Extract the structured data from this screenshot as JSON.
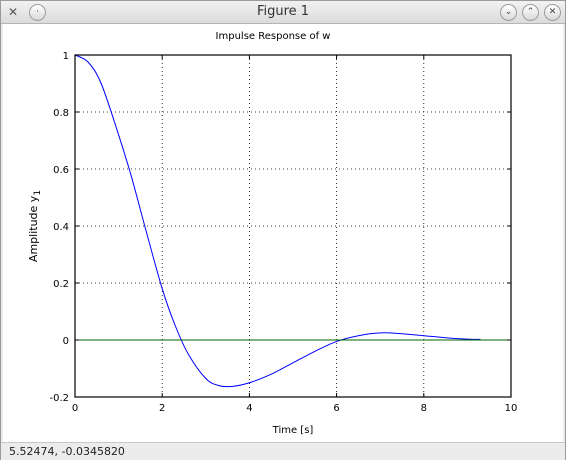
{
  "window": {
    "title": "Figure 1",
    "app_icon": "matplotlib-x-icon",
    "buttons": [
      {
        "name": "minimize",
        "glyph": "⌄"
      },
      {
        "name": "maximize",
        "glyph": "⌃"
      },
      {
        "name": "close",
        "glyph": "✕"
      }
    ],
    "menu_button_glyph": "·"
  },
  "status": {
    "coordinates": "5.52474, -0.0345820"
  },
  "chart_data": {
    "type": "line",
    "title": "Impulse Response of w",
    "xlabel": "Time [s]",
    "ylabel": "Amplitude y",
    "ylabel_subscript": "1",
    "xlim": [
      0,
      10
    ],
    "ylim": [
      -0.2,
      1
    ],
    "xticks": [
      0,
      2,
      4,
      6,
      8,
      10
    ],
    "yticks": [
      -0.2,
      0,
      0.2,
      0.4,
      0.6,
      0.8,
      1
    ],
    "grid": true,
    "series": [
      {
        "color": "#0000ff",
        "x": [
          0,
          0.3,
          0.6,
          1.0,
          1.3,
          1.6,
          2.0,
          2.3,
          2.6,
          3.0,
          3.3,
          3.6,
          4.0,
          4.5,
          5.0,
          5.5,
          6.0,
          6.5,
          7.0,
          7.5,
          8.0,
          8.5,
          9.0,
          9.3
        ],
        "y": [
          1.0,
          0.975,
          0.9,
          0.72,
          0.57,
          0.4,
          0.18,
          0.05,
          -0.05,
          -0.135,
          -0.16,
          -0.163,
          -0.15,
          -0.12,
          -0.08,
          -0.04,
          -0.005,
          0.015,
          0.025,
          0.022,
          0.015,
          0.008,
          0.003,
          0.002
        ]
      },
      {
        "color": "#006400",
        "x": [
          0,
          10
        ],
        "y": [
          0,
          0
        ]
      }
    ]
  }
}
